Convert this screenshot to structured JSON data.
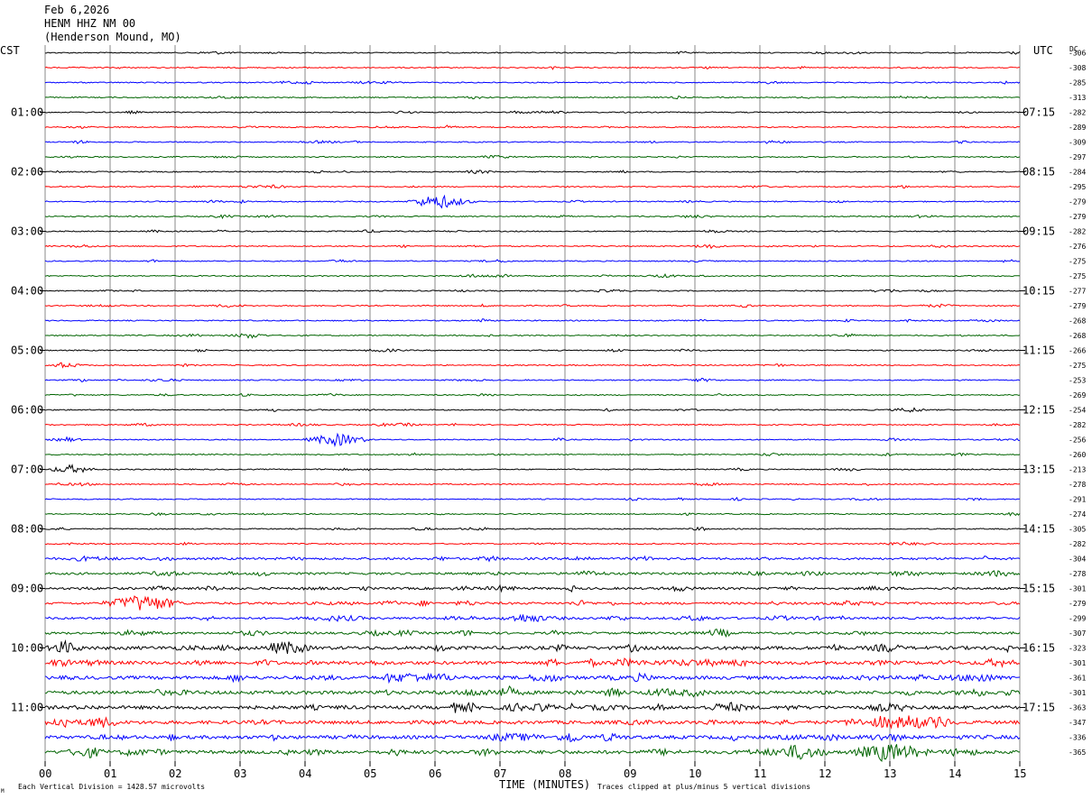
{
  "header": {
    "date": "Feb 6,2026",
    "station": "HENM HHZ NM 00",
    "location": "(Henderson Mound, MO)"
  },
  "labels": {
    "left_tz": "CST",
    "right_tz": "UTC",
    "dc_label": "DC",
    "xlabel": "TIME (MINUTES)",
    "footer_left": "Each Vertical Division = 1428.57 microvolts",
    "footer_right": "Traces clipped at plus/minus 5 vertical divisions",
    "corner_mark": "M"
  },
  "chart_data": {
    "type": "line",
    "title": "HENM HHZ NM 00 (Henderson Mound, MO)",
    "xlabel": "TIME (MINUTES)",
    "ylabel": "",
    "xlim": [
      0,
      15
    ],
    "x_ticks": [
      "00",
      "01",
      "02",
      "03",
      "04",
      "05",
      "06",
      "07",
      "08",
      "09",
      "10",
      "11",
      "12",
      "13",
      "14",
      "15"
    ],
    "trace_colors": [
      "#000000",
      "#ff0000",
      "#0000ff",
      "#006400"
    ],
    "grid": true,
    "left_hour_labels": [
      "01:00",
      "02:00",
      "03:00",
      "04:00",
      "05:00",
      "06:00",
      "07:00",
      "08:00",
      "09:00",
      "10:00",
      "11:00"
    ],
    "right_hour_labels": [
      "07:15",
      "08:15",
      "09:15",
      "10:15",
      "11:15",
      "12:15",
      "13:15",
      "14:15",
      "15:15",
      "16:15",
      "17:15"
    ],
    "dc_offsets": [
      -306,
      -308,
      -285,
      -313,
      -282,
      -289,
      -309,
      -297,
      -284,
      -295,
      -279,
      -279,
      -282,
      -276,
      -275,
      -275,
      -277,
      -279,
      -268,
      -268,
      -266,
      -275,
      -253,
      -269,
      -254,
      -282,
      -256,
      -260,
      -213,
      -278,
      -291,
      -274,
      -305,
      -282,
      -304,
      -278,
      -301,
      -279,
      -299,
      -307,
      -323,
      -301,
      -361,
      -301,
      -363,
      -347,
      -336,
      -365
    ],
    "trace_noise_level": [
      1,
      1,
      1,
      1,
      1,
      1,
      1,
      1,
      1,
      1,
      1,
      1,
      1,
      1,
      1,
      1,
      1,
      1,
      1,
      1,
      1,
      1,
      1,
      1,
      1,
      1,
      1,
      1,
      1,
      1,
      1,
      1,
      1,
      1,
      2,
      2,
      2,
      2,
      2,
      2,
      3,
      3,
      3,
      3,
      3,
      3,
      3,
      3
    ],
    "events": [
      {
        "trace": 10,
        "minute": 6.1,
        "strength": 3
      },
      {
        "trace": 13,
        "minute": 10.2,
        "strength": 1
      },
      {
        "trace": 19,
        "minute": 12.3,
        "strength": 1
      },
      {
        "trace": 26,
        "minute": 4.5,
        "strength": 3
      },
      {
        "trace": 28,
        "minute": 0.4,
        "strength": 2
      },
      {
        "trace": 37,
        "minute": 1.5,
        "strength": 4
      },
      {
        "trace": 38,
        "minute": 7.4,
        "strength": 2
      },
      {
        "trace": 42,
        "minute": 5.6,
        "strength": 2
      },
      {
        "trace": 44,
        "minute": 10.5,
        "strength": 2
      },
      {
        "trace": 45,
        "minute": 13.3,
        "strength": 3
      },
      {
        "trace": 47,
        "minute": 11.6,
        "strength": 3
      },
      {
        "trace": 47,
        "minute": 13.0,
        "strength": 4
      }
    ]
  }
}
